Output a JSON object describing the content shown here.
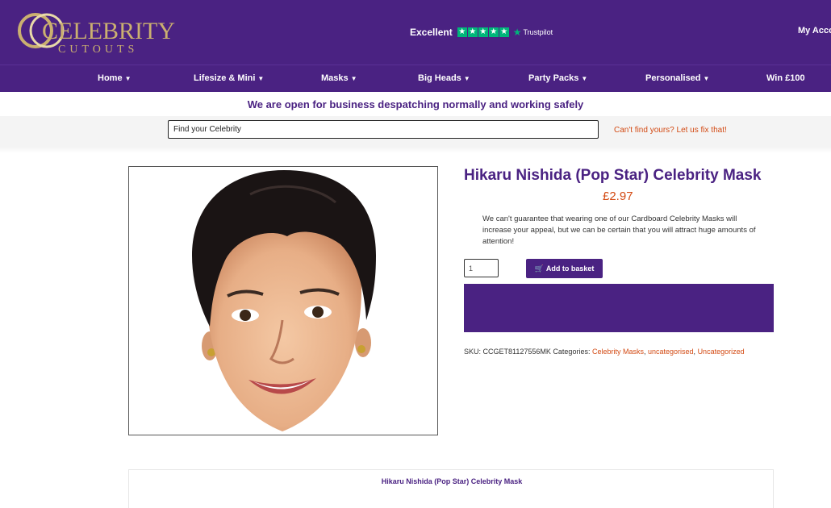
{
  "brand": {
    "line1": "CELEBRITY",
    "line2": "CUTOUTS",
    "gold": "#cbb070",
    "purple": "#4a2282",
    "accent_orange": "#d34a13",
    "trustpilot_green": "#00b67a"
  },
  "header": {
    "rating_label": "Excellent",
    "rating_stars": 5,
    "rating_source": "Trustpilot",
    "account_label": "My Acco"
  },
  "nav": {
    "items": [
      {
        "label": "Home",
        "icon": "chevron-down-icon"
      },
      {
        "label": "Lifesize & Mini",
        "icon": "chevron-down-icon"
      },
      {
        "label": "Masks",
        "icon": "chevron-down-icon"
      },
      {
        "label": "Big Heads",
        "icon": "chevron-down-icon"
      },
      {
        "label": "Party Packs",
        "icon": "chevron-down-icon"
      },
      {
        "label": "Personalised",
        "icon": "chevron-down-icon"
      },
      {
        "label": "Win £100"
      }
    ]
  },
  "notice": "We are open for business despatching normally and working safely",
  "search": {
    "placeholder": "Find your Celebrity",
    "cant_find": "Can't find yours? Let us fix that!"
  },
  "product": {
    "title": "Hikaru Nishida (Pop Star) Celebrity Mask",
    "price": "£2.97",
    "description": "We can't guarantee that wearing one of our Cardboard Celebrity Masks will increase your appeal, but we can be certain that you will attract huge amounts of attention!",
    "quantity": "1",
    "add_button": "Add to basket",
    "add_icon": "cart-icon",
    "sku_label": "SKU:",
    "sku": "CCGET81127556MK",
    "categories_label": "Categories:",
    "categories": [
      "Celebrity Masks",
      "uncategorised",
      "Uncategorized"
    ]
  },
  "tabs": {
    "title": "Hikaru Nishida (Pop Star) Celebrity Mask"
  }
}
